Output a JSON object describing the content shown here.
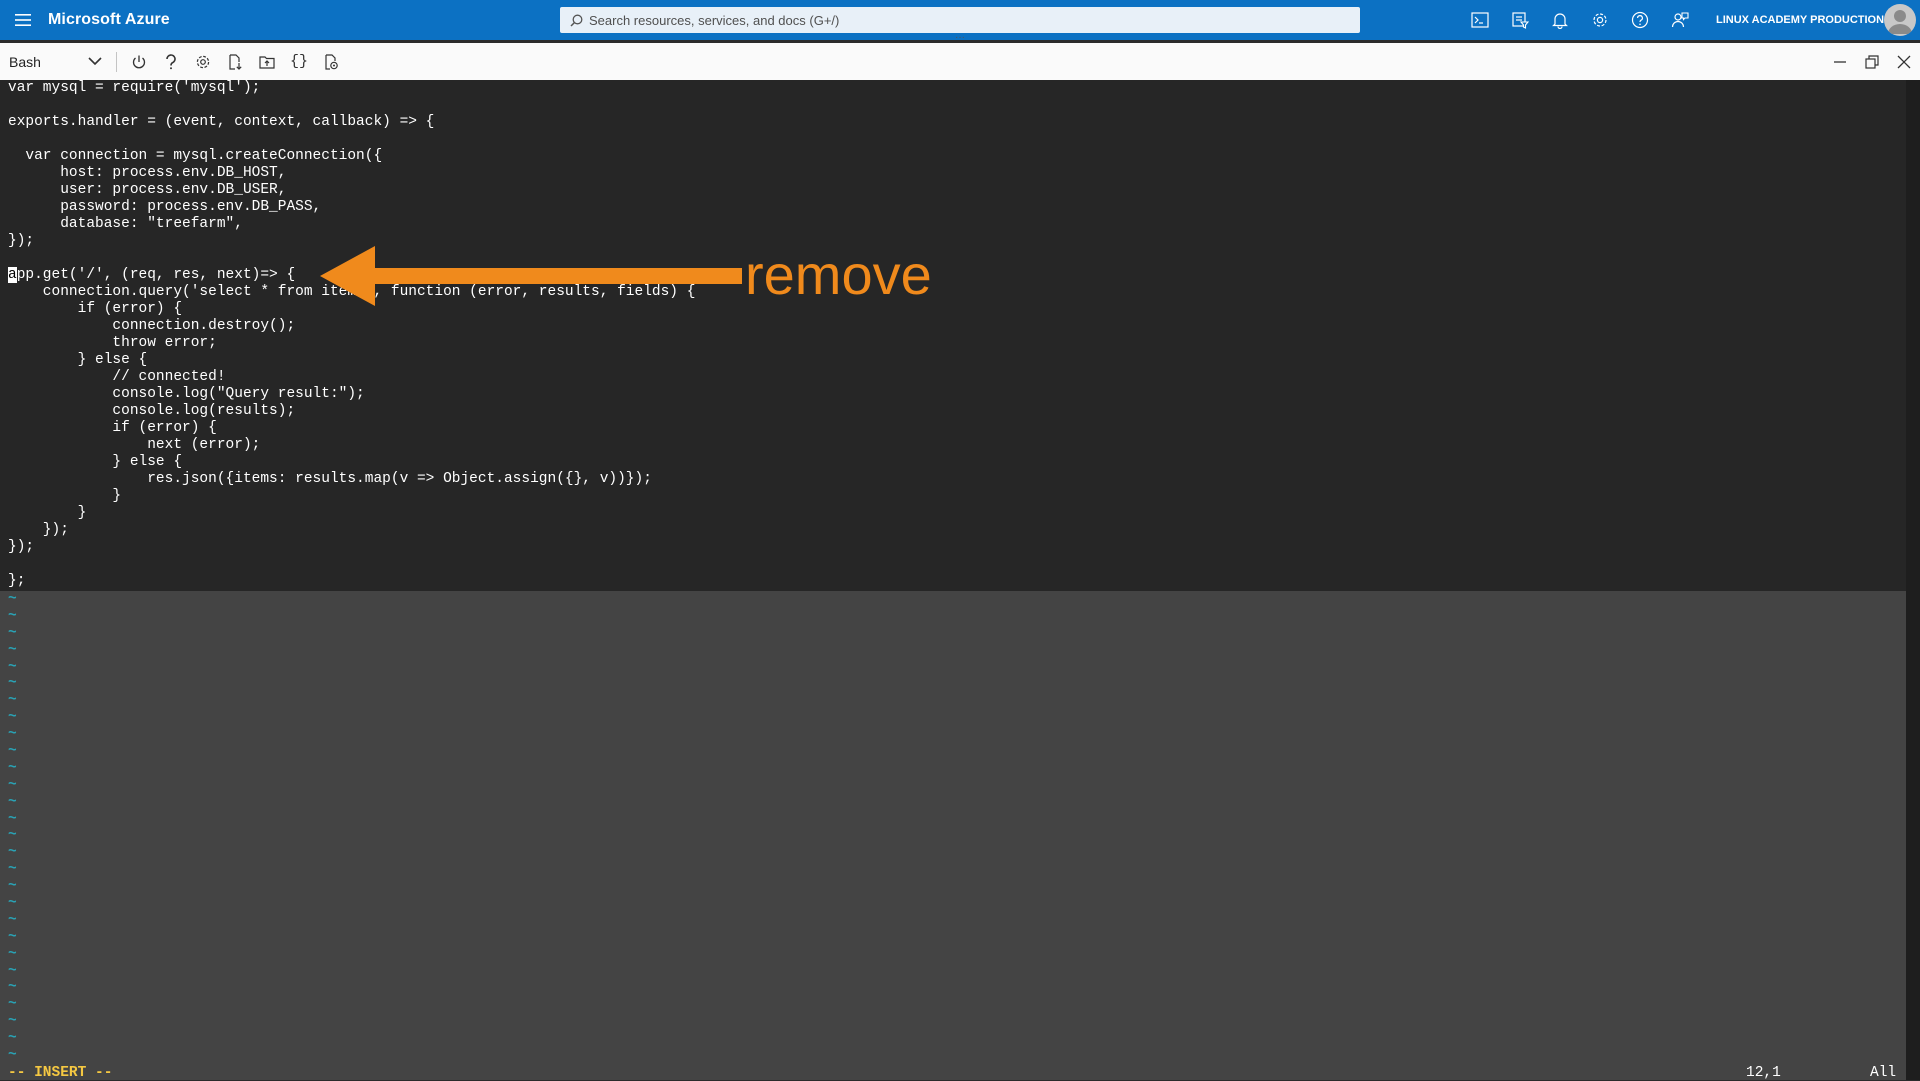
{
  "header": {
    "brand": "Microsoft Azure",
    "search_placeholder": "Search resources, services, and docs (G+/)",
    "account": "LINUX ACADEMY PRODUCTION ...",
    "icons": [
      "cloud-shell-icon",
      "directory-filter-icon",
      "bell-icon",
      "gear-icon",
      "help-icon",
      "feedback-icon"
    ]
  },
  "shell": {
    "selector": "Bash",
    "toolbar_icons": [
      "power-icon",
      "help-icon",
      "gear-icon",
      "upload-download-icon",
      "open-folder-icon",
      "braces-icon",
      "web-preview-icon"
    ],
    "window_icons": [
      "minimize-icon",
      "restore-icon",
      "close-icon"
    ]
  },
  "editor": {
    "lines": [
      "var mysql = require('mysql');",
      "",
      "exports.handler = (event, context, callback) => {",
      "",
      "  var connection = mysql.createConnection({",
      "      host: process.env.DB_HOST,",
      "      user: process.env.DB_USER,",
      "      password: process.env.DB_PASS,",
      "      database: \"treefarm\",",
      "});",
      "",
      "app.get('/', (req, res, next)=> {",
      "    connection.query('select * from items', function (error, results, fields) {",
      "        if (error) {",
      "            connection.destroy();",
      "            throw error;",
      "        } else {",
      "            // connected!",
      "            console.log(\"Query result:\");",
      "            console.log(results);",
      "            if (error) {",
      "                next (error);",
      "            } else {",
      "                res.json({items: results.map(v => Object.assign({}, v))});",
      "            }",
      "        }",
      "    });",
      "});",
      "",
      "};"
    ],
    "cursor_line": 12,
    "cursor_col": 1,
    "mode": "-- INSERT --",
    "position": "12,1",
    "scope": "All",
    "annotation": "remove"
  }
}
